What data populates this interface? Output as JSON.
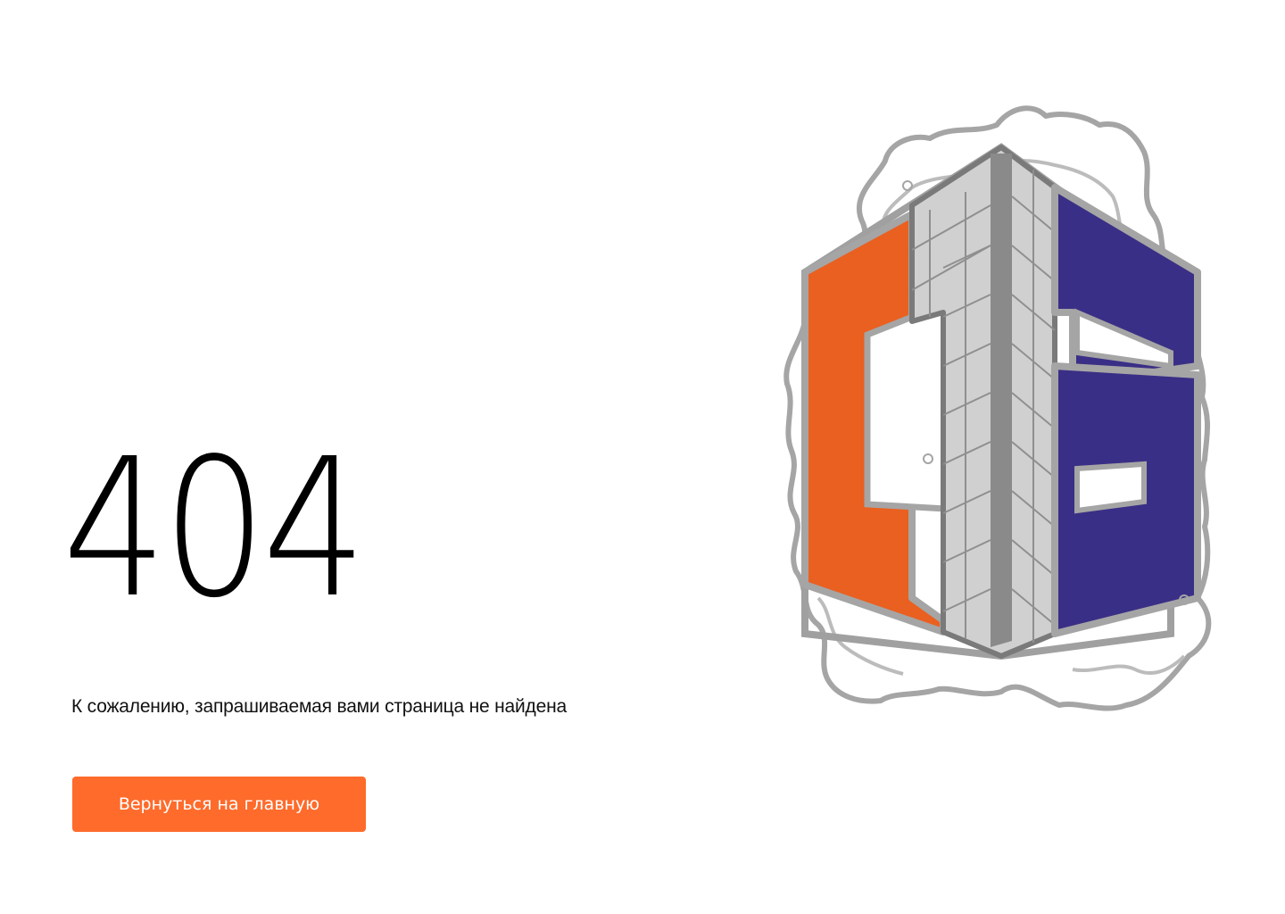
{
  "error": {
    "code": "404",
    "message": "К сожалению, запрашиваемая вами страница не найдена"
  },
  "actions": {
    "home_button_label": "Вернуться на главную"
  },
  "logo": {
    "icon": "company-logo-building",
    "colors": {
      "orange": "#e96020",
      "blue": "#3a2f86",
      "gray": "#a5a5a5",
      "light_gray": "#d0d0d0",
      "dark_gray": "#777777"
    }
  },
  "colors": {
    "accent": "#ff6b2b",
    "text": "#000000",
    "background": "#ffffff"
  }
}
